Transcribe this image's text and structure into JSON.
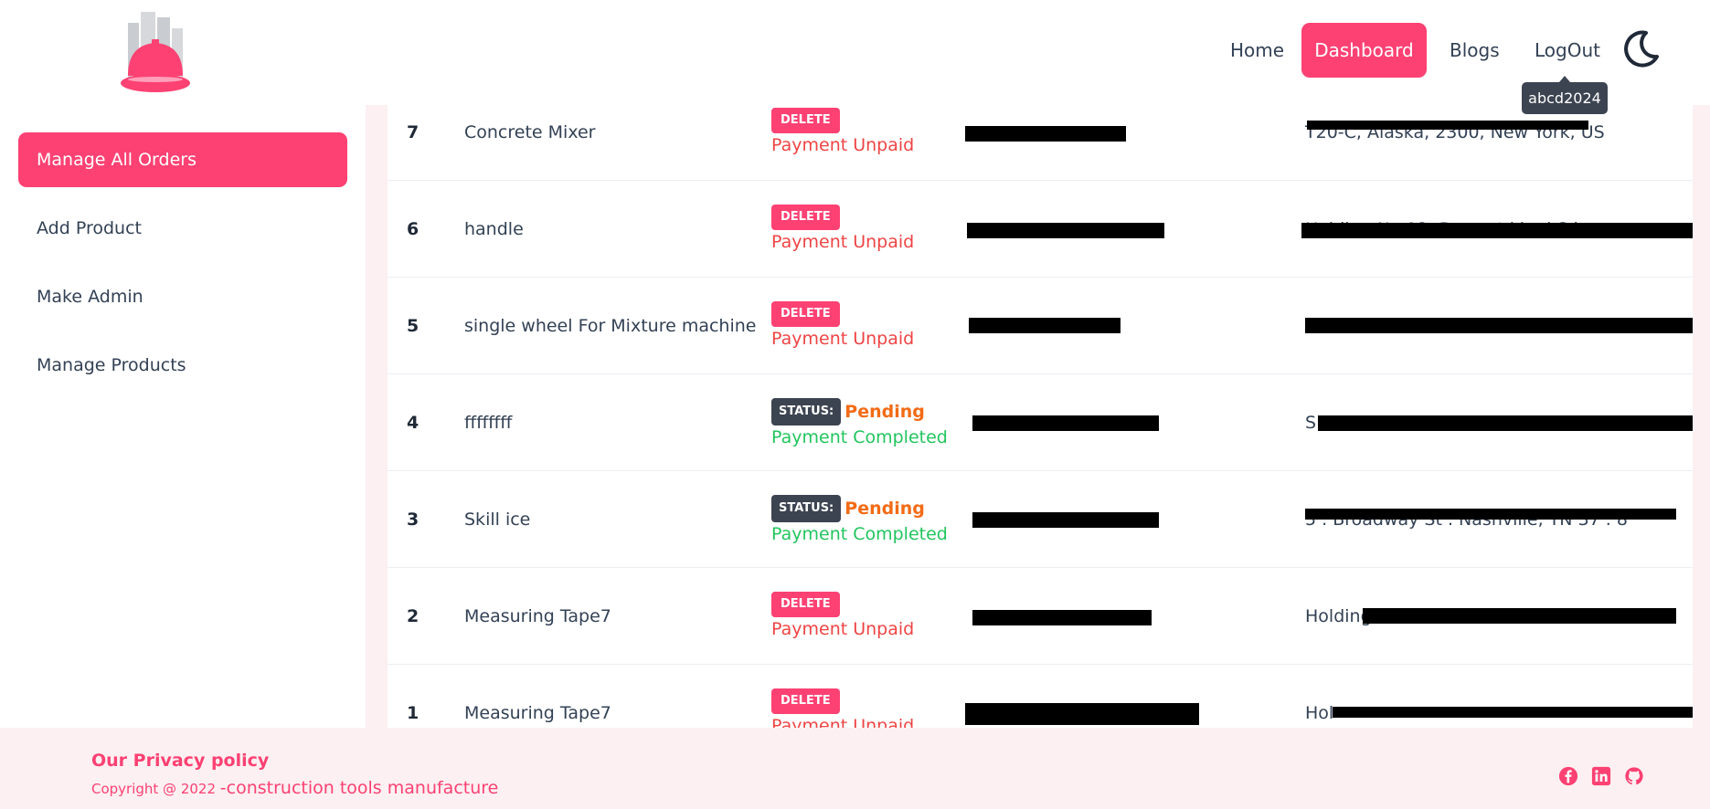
{
  "nav": {
    "links": [
      "Home",
      "Dashboard",
      "Blogs",
      "LogOut"
    ],
    "tooltip": "abcd2024",
    "colors": {
      "accent": "#fd4173",
      "tooltip_bg": "#3d4451"
    }
  },
  "sidebar": {
    "items": [
      {
        "label": "Manage All Orders",
        "active": true
      },
      {
        "label": "Add Product"
      },
      {
        "label": "Make Admin"
      },
      {
        "label": "Manage Products"
      }
    ]
  },
  "orders": {
    "rows": [
      {
        "num": "7",
        "name": "Concrete Mixer",
        "action": "DELETE",
        "payment": "Payment Unpaid",
        "address": "T20-C, Alaska, 2300, New York, US"
      },
      {
        "num": "6",
        "name": "handle",
        "action": "DELETE",
        "payment": "Payment Unpaid",
        "address": "Holding No 12, Dry  ent  ki  g  i S  k  r"
      },
      {
        "num": "5",
        "name": "single wheel For Mixture machine",
        "action": "DELETE",
        "payment": "Payment Unpaid",
        "address": ""
      },
      {
        "num": "4",
        "name": "ffffffff",
        "status_label": "STATUS:",
        "status": "Pending",
        "payment": "Payment Completed",
        "address": "S"
      },
      {
        "num": "3",
        "name": "Skill ice",
        "status_label": "STATUS:",
        "status": "Pending",
        "payment": "Payment Completed",
        "address": "5 . Broadway St . Nashville, TN 37 . 8"
      },
      {
        "num": "2",
        "name": "Measuring Tape7",
        "action": "DELETE",
        "payment": "Payment Unpaid",
        "address": "Holding                                  dar"
      },
      {
        "num": "1",
        "name": "Measuring Tape7",
        "action": "DELETE",
        "payment": "Payment Unpaid",
        "address": "Hol"
      }
    ],
    "colors": {
      "unpaid": "#ef4444",
      "completed": "#22c55e",
      "pending": "#f36b16"
    }
  },
  "footer": {
    "privacy": "Our Privacy policy",
    "copyright": "Copyright @ 2022 ",
    "brand": "-construction tools manufacture",
    "social_icons": [
      "facebook-icon",
      "linkedin-icon",
      "github-icon"
    ]
  }
}
